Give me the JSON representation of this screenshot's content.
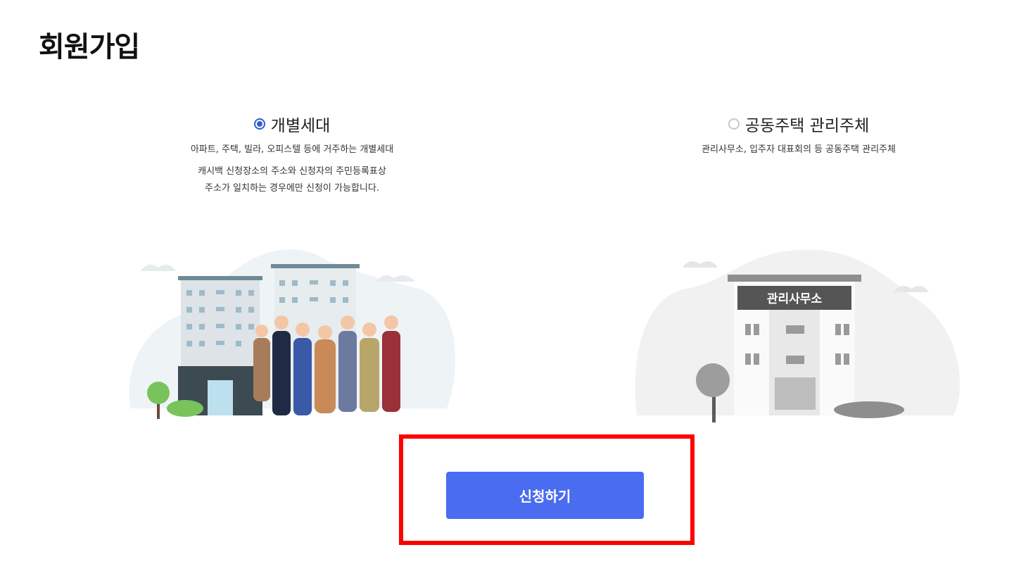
{
  "page": {
    "title": "회원가입"
  },
  "options": [
    {
      "label": "개별세대",
      "selected": true,
      "description": "아파트, 주택, 빌라, 오피스텔 등에 거주하는 개별세대",
      "note_line1": "캐시백 신청장소의 주소와 신청자의 주민등록표상",
      "note_line2": "주소가 일치하는 경우에만 신청이 가능합니다."
    },
    {
      "label": "공동주택 관리주체",
      "selected": false,
      "description": "관리사무소, 입주자 대표회의 등 공동주택 관리주체",
      "sign": "관리사무소"
    }
  ],
  "cta": {
    "label": "신청하기"
  },
  "colors": {
    "accent": "#4a6cf0",
    "radio": "#2f5fd0",
    "highlight": "#ff0000"
  }
}
